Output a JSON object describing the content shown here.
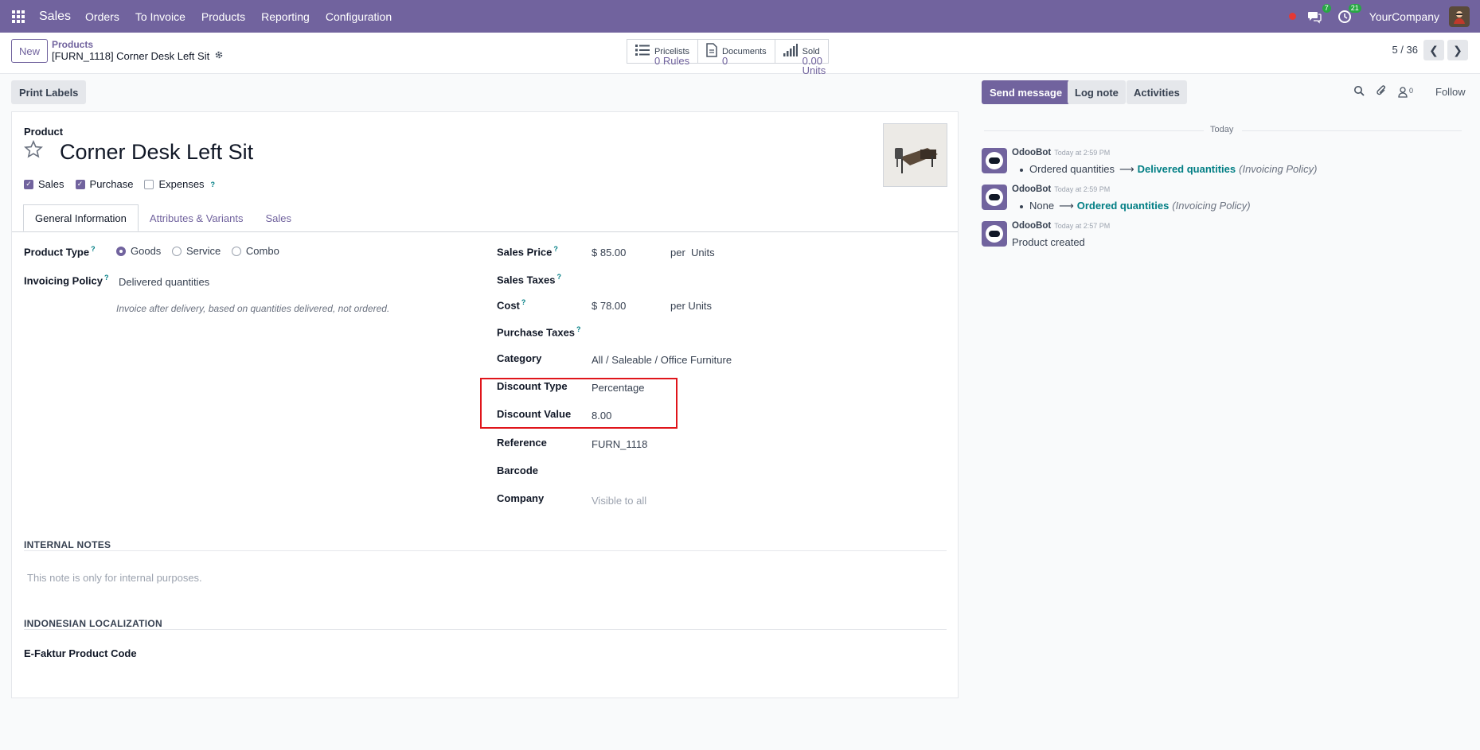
{
  "navbar": {
    "brand": "Sales",
    "menu": [
      "Orders",
      "To Invoice",
      "Products",
      "Reporting",
      "Configuration"
    ],
    "messages_badge": "7",
    "activities_badge": "21",
    "company": "YourCompany"
  },
  "control": {
    "new_label": "New",
    "breadcrumb_parent": "Products",
    "breadcrumb_current": "[FURN_1118] Corner Desk Left Sit",
    "smart_buttons": [
      {
        "title": "Pricelists",
        "value": "0 Rules",
        "icon": "list-icon"
      },
      {
        "title": "Documents",
        "value": "0",
        "icon": "document-icon"
      },
      {
        "title": "Sold",
        "value": "0.00 Units",
        "icon": "signal-icon"
      }
    ],
    "pager": "5 / 36"
  },
  "actions": {
    "print_labels": "Print Labels"
  },
  "form": {
    "product_label": "Product",
    "product_name": "Corner Desk Left Sit",
    "checkboxes": [
      {
        "label": "Sales",
        "checked": true
      },
      {
        "label": "Purchase",
        "checked": true
      },
      {
        "label": "Expenses",
        "checked": false
      }
    ],
    "tabs": [
      "General Information",
      "Attributes & Variants",
      "Sales"
    ],
    "product_type_label": "Product Type",
    "product_type_options": [
      "Goods",
      "Service",
      "Combo"
    ],
    "product_type_selected": "Goods",
    "invoicing_policy_label": "Invoicing Policy",
    "invoicing_policy_value": "Delivered quantities",
    "invoicing_help": "Invoice after delivery, based on quantities delivered, not ordered.",
    "sales_price_label": "Sales Price",
    "sales_price_value": "$ 85.00",
    "sales_price_unit": "per  Units",
    "sales_taxes_label": "Sales Taxes",
    "cost_label": "Cost",
    "cost_value": "$ 78.00",
    "cost_unit": "per Units",
    "purchase_taxes_label": "Purchase Taxes",
    "category_label": "Category",
    "category_value": "All / Saleable / Office Furniture",
    "discount_type_label": "Discount Type",
    "discount_type_value": "Percentage",
    "discount_value_label": "Discount Value",
    "discount_value_value": "8.00",
    "reference_label": "Reference",
    "reference_value": "FURN_1118",
    "barcode_label": "Barcode",
    "company_label": "Company",
    "company_placeholder": "Visible to all",
    "internal_notes_title": "INTERNAL NOTES",
    "internal_notes_placeholder": "This note is only for internal purposes.",
    "localization_title": "INDONESIAN LOCALIZATION",
    "efaktur_label": "E-Faktur Product Code"
  },
  "chatter": {
    "send_message": "Send message",
    "log_note": "Log note",
    "activities": "Activities",
    "followers_count": "0",
    "follow": "Follow",
    "today": "Today",
    "messages": [
      {
        "author": "OdooBot",
        "time": "Today at 2:59 PM",
        "old": "Ordered quantities",
        "new": "Delivered quantities",
        "field": "(Invoicing Policy)"
      },
      {
        "author": "OdooBot",
        "time": "Today at 2:59 PM",
        "old": "None",
        "new": "Ordered quantities",
        "field": "(Invoicing Policy)"
      },
      {
        "author": "OdooBot",
        "time": "Today at 2:57 PM",
        "text": "Product created"
      }
    ]
  },
  "colors": {
    "brand": "#71639e",
    "link": "#017e84",
    "highlight_border": "#e0151b"
  }
}
